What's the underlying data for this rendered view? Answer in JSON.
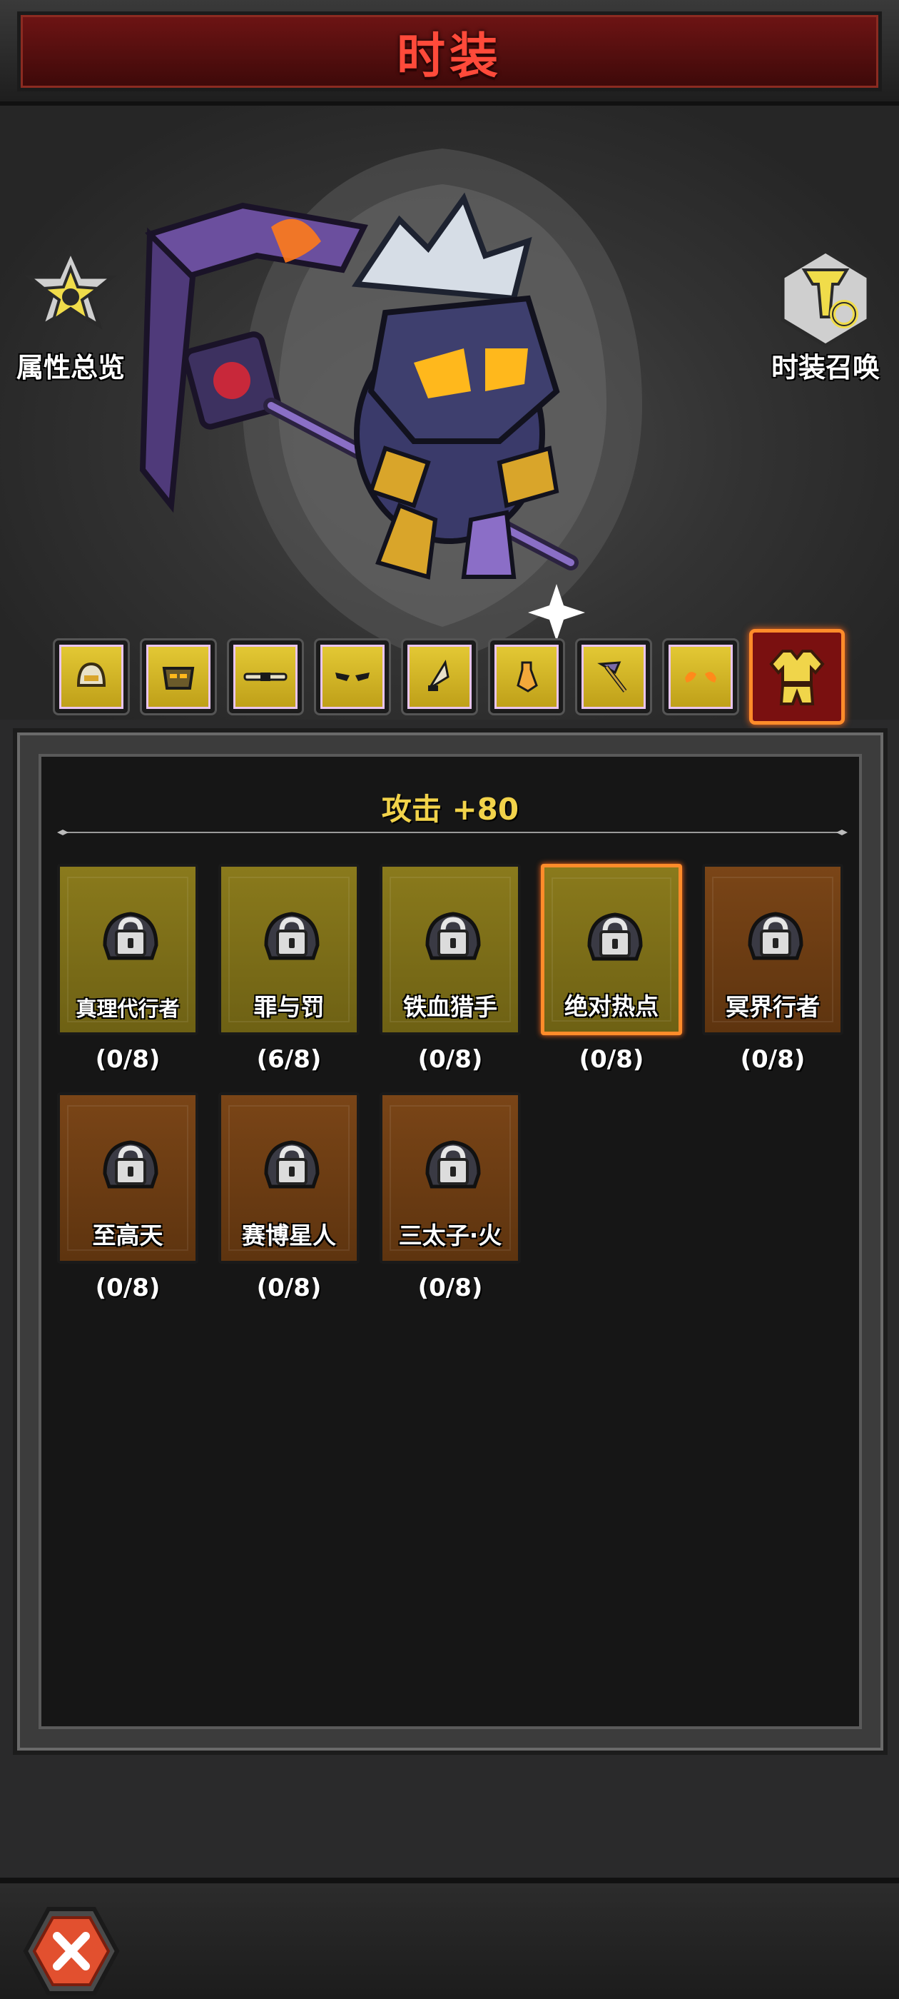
{
  "header": {
    "title": "时装"
  },
  "side_buttons": {
    "left_label": "属性总览",
    "right_label": "时装召唤"
  },
  "slots": [
    {
      "icon": "helmet-icon"
    },
    {
      "icon": "mask-icon"
    },
    {
      "icon": "bar-icon"
    },
    {
      "icon": "eyes-icon"
    },
    {
      "icon": "blade-icon"
    },
    {
      "icon": "vial-icon"
    },
    {
      "icon": "axe-icon"
    },
    {
      "icon": "flame-eyes-icon"
    },
    {
      "icon": "outfit-icon",
      "selected": true
    }
  ],
  "stat": {
    "text": "攻击 +80"
  },
  "cards": [
    {
      "name": "真理代行者",
      "count": "(0/8)",
      "style": "gold"
    },
    {
      "name": "罪与罚",
      "count": "(6/8)",
      "style": "gold"
    },
    {
      "name": "铁血猎手",
      "count": "(0/8)",
      "style": "gold"
    },
    {
      "name": "绝对热点",
      "count": "(0/8)",
      "style": "gold",
      "selected": true
    },
    {
      "name": "冥界行者",
      "count": "(0/8)",
      "style": "brown"
    },
    {
      "name": "至高天",
      "count": "(0/8)",
      "style": "brown"
    },
    {
      "name": "赛博星人",
      "count": "(0/8)",
      "style": "brown"
    },
    {
      "name": "三太子·火",
      "count": "(0/8)",
      "style": "brown"
    }
  ],
  "colors": {
    "title_red": "#ff4a3a",
    "stat_gold": "#f2d34a",
    "selected_orange": "#ff8c2a",
    "card_gold": "#8a7a1c",
    "card_brown": "#7a4517"
  }
}
